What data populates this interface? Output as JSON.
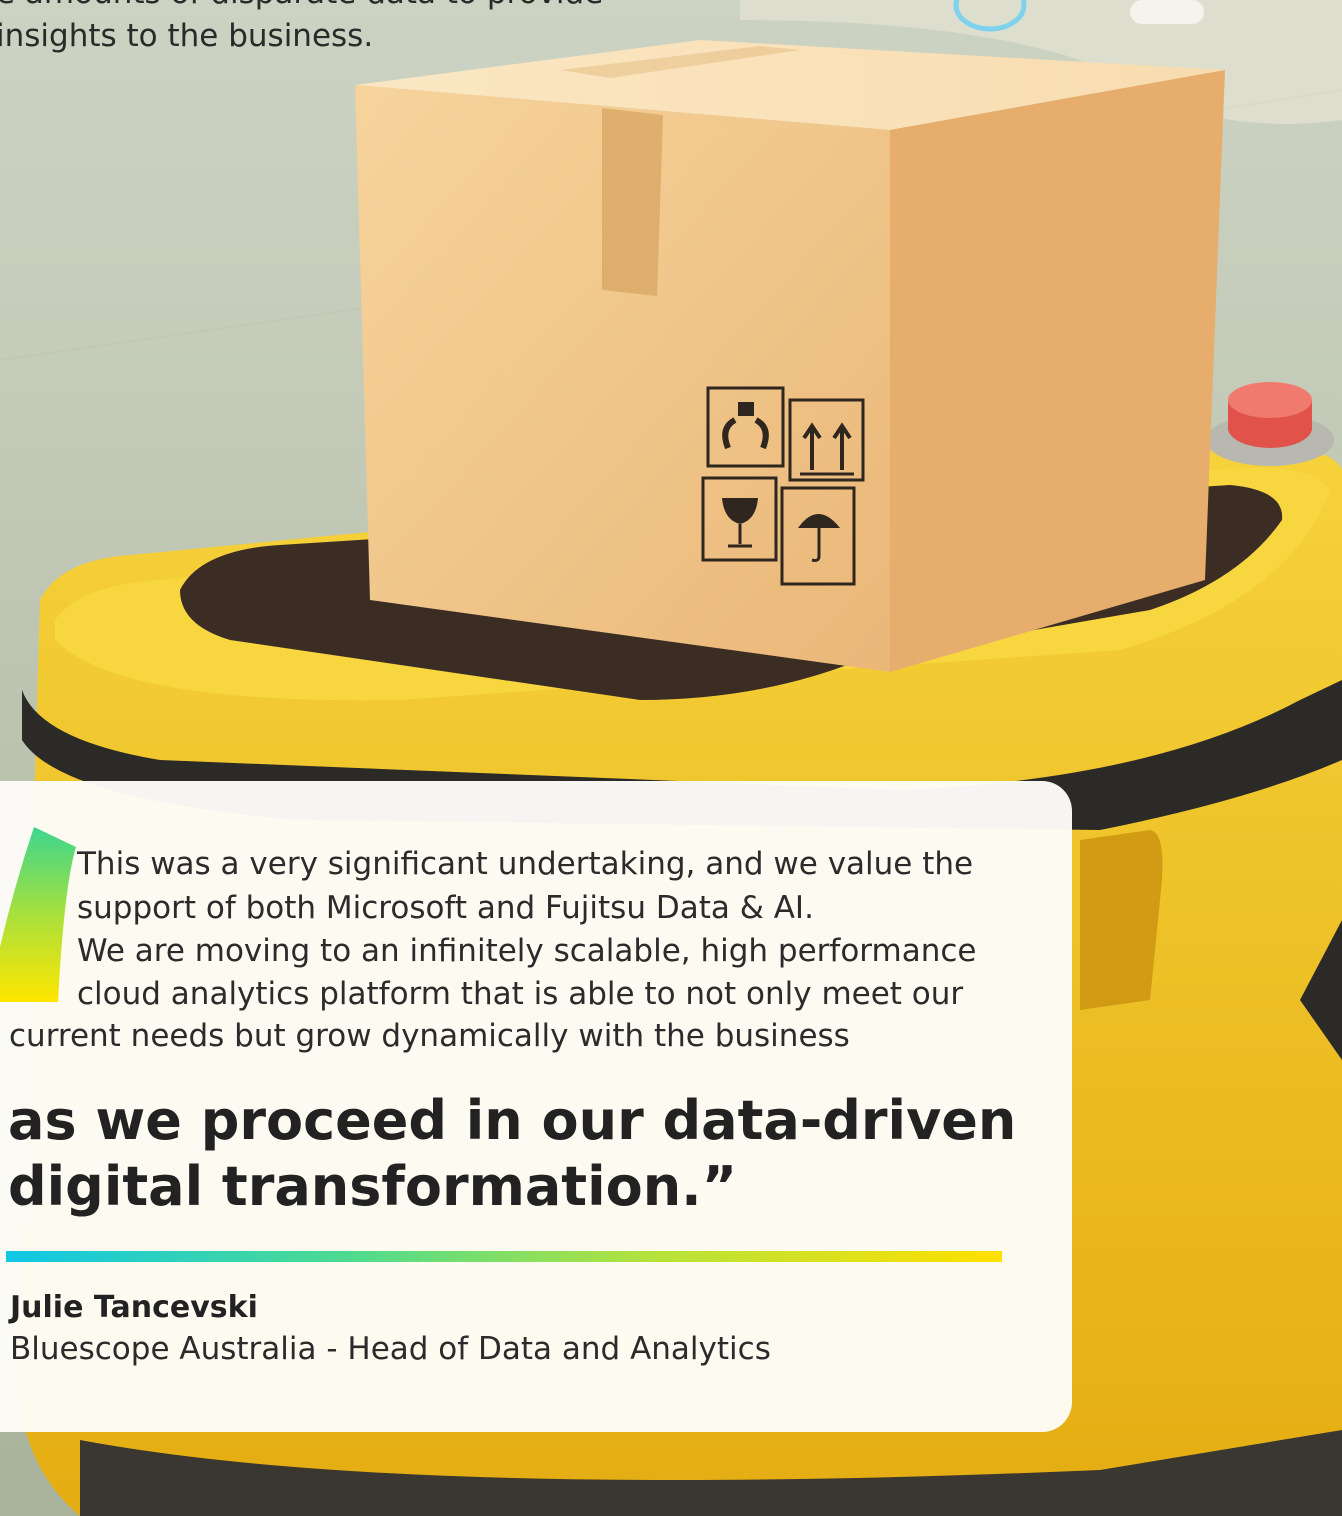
{
  "intro": {
    "line1": "e amounts of disparate data to provide",
    "line2": "insights to the business."
  },
  "testimonial": {
    "quote_lines": [
      "This was a very significant undertaking, and we value the",
      "support of both Microsoft and Fujitsu Data & AI.",
      "We are moving to an infinitely scalable, high performance",
      "cloud analytics platform that is able to not only meet our",
      "current needs but grow dynamically with the business"
    ],
    "headline_lines": [
      "as we proceed in our data-driven",
      "digital transformation.”"
    ],
    "author": "Julie Tancevski",
    "role": "Bluescope Australia - Head of Data and Analytics"
  },
  "colors": {
    "gradient_start": "#10c7e6",
    "gradient_end": "#ffe000",
    "robot_yellow": "#f2c21a",
    "box": "#f1c98a"
  },
  "icons": [
    "quote-mark-icon",
    "fragile-hands-icon",
    "this-way-up-icon",
    "fragile-glass-icon",
    "keep-dry-icon"
  ]
}
